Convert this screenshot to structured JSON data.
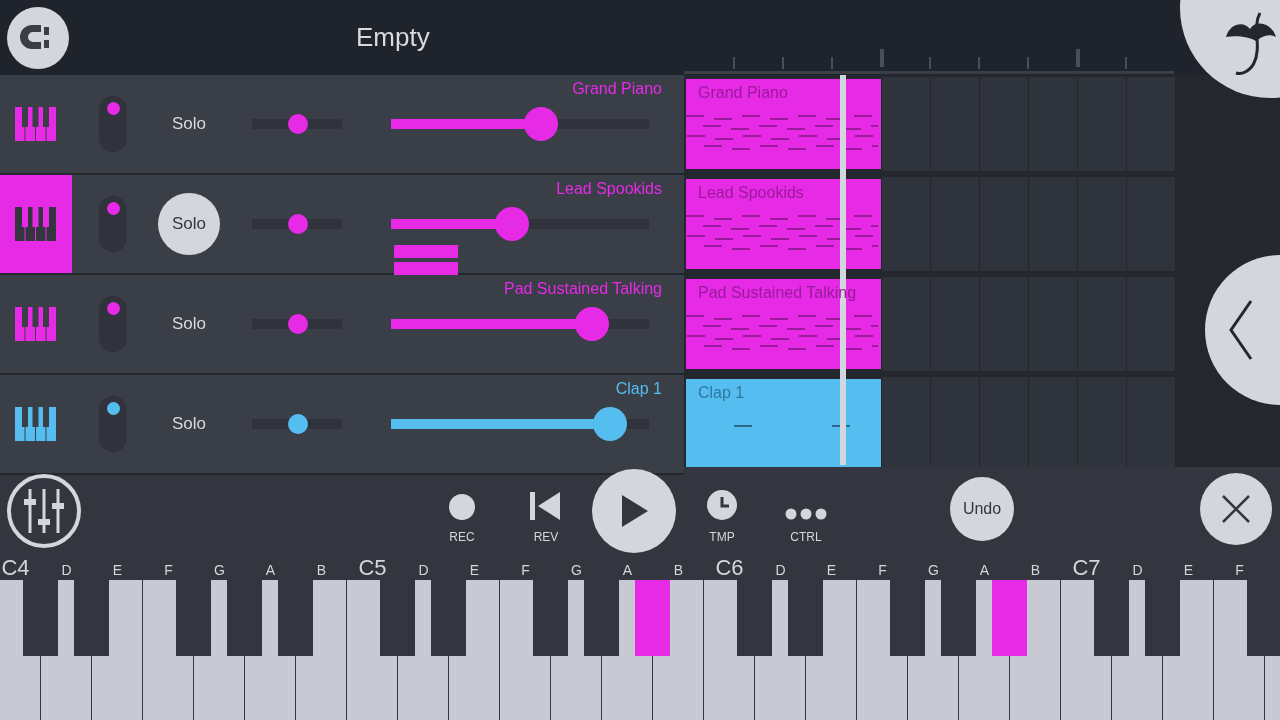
{
  "header": {
    "title": "Empty"
  },
  "tracks": [
    {
      "name": "Grand Piano",
      "color": "#e62ae6",
      "selected": false,
      "enabled": true,
      "solo": {
        "label": "Solo",
        "on": false
      },
      "pan": {
        "level": 0.5
      },
      "volume": {
        "level": 0.58
      }
    },
    {
      "name": "Lead Spookids",
      "color": "#e62ae6",
      "selected": true,
      "enabled": true,
      "solo": {
        "label": "Solo",
        "on": true
      },
      "pan": {
        "level": 0.5
      },
      "volume": {
        "level": 0.47
      },
      "meter": true
    },
    {
      "name": "Pad Sustained Talking",
      "color": "#e62ae6",
      "selected": false,
      "enabled": true,
      "solo": {
        "label": "Solo",
        "on": false
      },
      "pan": {
        "level": 0.5
      },
      "volume": {
        "level": 0.78
      }
    },
    {
      "name": "Clap 1",
      "color": "#55bdf0",
      "selected": false,
      "enabled": true,
      "solo": {
        "label": "Solo",
        "on": false
      },
      "pan": {
        "level": 0.5
      },
      "volume": {
        "level": 0.85
      }
    }
  ],
  "clips": [
    {
      "label": "Grand Piano",
      "color": "#e62ae6",
      "kind": "melody"
    },
    {
      "label": "Lead Spookids",
      "color": "#e62ae6",
      "kind": "melody"
    },
    {
      "label": "Pad Sustained Talking",
      "color": "#e62ae6",
      "kind": "melody"
    },
    {
      "label": "Clap 1",
      "color": "#55bdf0",
      "kind": "drum"
    }
  ],
  "transport": [
    {
      "kind": "rec",
      "label": "REC"
    },
    {
      "kind": "rev",
      "label": "REV"
    },
    {
      "kind": "play"
    },
    {
      "kind": "tmp",
      "label": "TMP"
    },
    {
      "kind": "ctrl",
      "label": "CTRL"
    }
  ],
  "undo": "Undo",
  "white_keys": [
    {
      "label": "C4",
      "kind": "octave"
    },
    {
      "label": "D",
      "kind": "note"
    },
    {
      "label": "E",
      "kind": "note"
    },
    {
      "label": "F",
      "kind": "note"
    },
    {
      "label": "G",
      "kind": "note"
    },
    {
      "label": "A",
      "kind": "note"
    },
    {
      "label": "B",
      "kind": "note"
    },
    {
      "label": "C5",
      "kind": "octave"
    },
    {
      "label": "D",
      "kind": "note"
    },
    {
      "label": "E",
      "kind": "note"
    },
    {
      "label": "F",
      "kind": "note"
    },
    {
      "label": "G",
      "kind": "note"
    },
    {
      "label": "A",
      "kind": "note"
    },
    {
      "label": "B",
      "kind": "note"
    },
    {
      "label": "C6",
      "kind": "octave"
    },
    {
      "label": "D",
      "kind": "note"
    },
    {
      "label": "E",
      "kind": "note"
    },
    {
      "label": "F",
      "kind": "note"
    },
    {
      "label": "G",
      "kind": "note"
    },
    {
      "label": "A",
      "kind": "note"
    },
    {
      "label": "B",
      "kind": "note"
    },
    {
      "label": "C7",
      "kind": "octave"
    },
    {
      "label": "D",
      "kind": "note"
    },
    {
      "label": "E",
      "kind": "note"
    },
    {
      "label": "F",
      "kind": "note"
    }
  ],
  "black_keys": [
    {
      "pressed": false
    },
    {
      "pressed": false
    },
    {
      "pressed": false
    },
    {
      "pressed": false
    },
    {
      "pressed": false
    },
    {
      "pressed": false
    },
    {
      "pressed": false
    },
    {
      "pressed": false
    },
    {
      "pressed": false
    },
    {
      "pressed": true
    },
    {
      "pressed": false
    },
    {
      "pressed": false
    },
    {
      "pressed": false
    },
    {
      "pressed": false
    },
    {
      "pressed": true
    },
    {
      "pressed": false
    },
    {
      "pressed": false
    },
    {
      "pressed": false
    }
  ]
}
